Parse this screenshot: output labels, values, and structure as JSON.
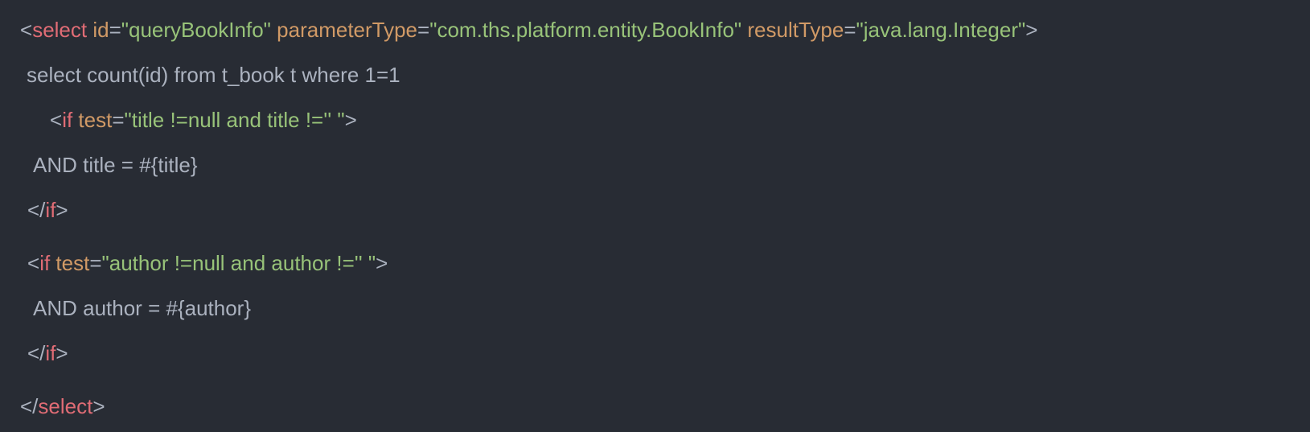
{
  "colors": {
    "background": "#282c34",
    "plain": "#abb2bf",
    "tag": "#e06c75",
    "attribute": "#d19a66",
    "string": "#98c379"
  },
  "code": {
    "line1": {
      "lt": "<",
      "tag": "select",
      "attr1": "id",
      "eq1": "=",
      "val1": "\"queryBookInfo\"",
      "attr2": "parameterType",
      "eq2": "=",
      "val2": "\"com.ths.platform.entity.BookInfo\"",
      "attr3": "resultType",
      "eq3": "=",
      "val3": "\"java.lang.Integer\"",
      "gt": ">"
    },
    "line2": {
      "text": "select count(id) from t_book t where 1=1"
    },
    "line3": {
      "lt": "<",
      "tag": "if",
      "attr": "test",
      "eq": "=",
      "val": "\"title !=null and title !='' \"",
      "gt": ">"
    },
    "line4": {
      "text": "AND title = #{title}"
    },
    "line5": {
      "lt": "</",
      "tag": "if",
      "gt": ">"
    },
    "line6": {
      "lt": "<",
      "tag": "if",
      "attr": "test",
      "eq": "=",
      "val": "\"author !=null and author !='' \"",
      "gt": ">"
    },
    "line7": {
      "text": "AND author = #{author}"
    },
    "line8": {
      "lt": "</",
      "tag": "if",
      "gt": ">"
    },
    "line9": {
      "lt": "</",
      "tag": "select",
      "gt": ">"
    }
  }
}
